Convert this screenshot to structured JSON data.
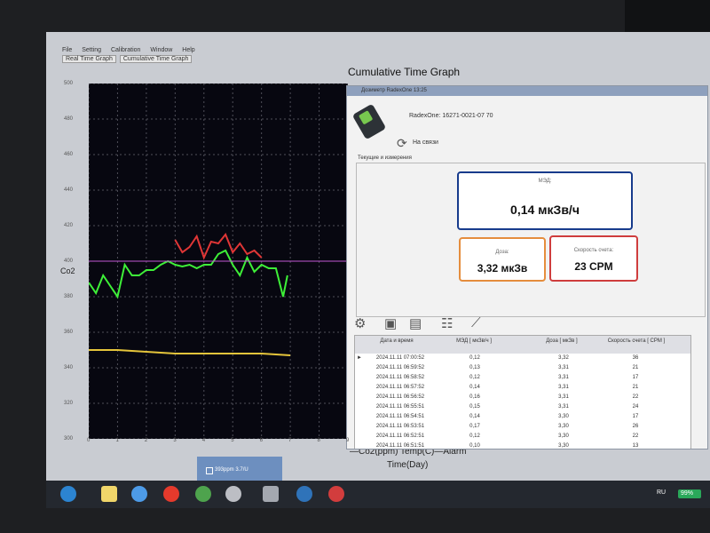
{
  "menu": {
    "items": [
      "File",
      "Setting",
      "Calibration",
      "Window",
      "Help"
    ]
  },
  "tabs": [
    "Real Time Graph",
    "Cumulative Time Graph"
  ],
  "graph": {
    "title": "Cumulative Time Graph",
    "y_axis_label": "Co2",
    "x_axis_label": "Time(Day)",
    "legend": "—Co2(ppm)  Temp(C)—Alarm",
    "status_box": "393ppm 3.7/U"
  },
  "chart_data": {
    "type": "line",
    "xlabel": "Time(Day)",
    "ylabel": "Co2",
    "xlim": [
      0,
      9
    ],
    "ylim": [
      300,
      500
    ],
    "x_ticks": [
      0,
      1,
      2,
      3,
      4,
      5,
      6,
      7,
      8,
      9
    ],
    "y_ticks": [
      300,
      320,
      340,
      360,
      380,
      400,
      420,
      440,
      460,
      480,
      500
    ],
    "grid": true,
    "legend_position": "bottom",
    "series": [
      {
        "name": "Co2(ppm)",
        "color": "#3ef038",
        "x": [
          0,
          0.25,
          0.5,
          0.75,
          1,
          1.25,
          1.5,
          1.75,
          2,
          2.25,
          2.5,
          2.75,
          3,
          3.25,
          3.5,
          3.75,
          4,
          4.25,
          4.5,
          4.75,
          5,
          5.25,
          5.5,
          5.75,
          6,
          6.25,
          6.5,
          6.75,
          6.9
        ],
        "values": [
          388,
          382,
          392,
          386,
          380,
          398,
          392,
          392,
          395,
          395,
          398,
          400,
          398,
          397,
          398,
          396,
          398,
          398,
          404,
          406,
          398,
          392,
          402,
          394,
          398,
          396,
          396,
          380,
          392
        ]
      },
      {
        "name": "Co2 over alarm",
        "color": "#e03636",
        "x": [
          3,
          3.25,
          3.5,
          3.75,
          4,
          4.25,
          4.5,
          4.75,
          5,
          5.25,
          5.5,
          5.75,
          6
        ],
        "values": [
          412,
          405,
          408,
          414,
          402,
          411,
          410,
          415,
          405,
          410,
          404,
          406,
          402
        ]
      },
      {
        "name": "Temp(C)",
        "color": "#e5c53b",
        "x": [
          0,
          1,
          2,
          3,
          4,
          5,
          6,
          7
        ],
        "values": [
          350,
          350,
          349,
          348,
          348,
          348,
          348,
          347
        ]
      },
      {
        "name": "Alarm",
        "color": "#c257d4",
        "x": [
          0,
          9
        ],
        "values": [
          400,
          400
        ]
      }
    ]
  },
  "dialog": {
    "title": "Дозиметр RadexOne 13:25",
    "device_name": "RadexOne: 16271-0021-07 70",
    "connection_status": "На связи",
    "group_label": "Текущие и измерения",
    "mad_label": "МЭД:",
    "mad_value": "0,14 мкЗв/ч",
    "dose_label": "Доза:",
    "dose_value": "3,32 мкЗв",
    "rate_label": "Скорость счета:",
    "rate_value": "23 CPM",
    "table": {
      "headers": [
        "Дата и время",
        "МЭД\n[ мкЗв/ч ]",
        "Доза\n[ мкЗв ]",
        "Скорость счета\n[ CPM ]"
      ],
      "rows": [
        [
          "2024.11.11 07:00:52",
          "0,12",
          "3,32",
          "36"
        ],
        [
          "2024.11.11 06:59:52",
          "0,13",
          "3,31",
          "21"
        ],
        [
          "2024.11.11 06:58:52",
          "0,12",
          "3,31",
          "17"
        ],
        [
          "2024.11.11 06:57:52",
          "0,14",
          "3,31",
          "21"
        ],
        [
          "2024.11.11 06:56:52",
          "0,16",
          "3,31",
          "22"
        ],
        [
          "2024.11.11 06:55:51",
          "0,15",
          "3,31",
          "24"
        ],
        [
          "2024.11.11 06:54:51",
          "0,14",
          "3,30",
          "17"
        ],
        [
          "2024.11.11 06:53:51",
          "0,17",
          "3,30",
          "26"
        ],
        [
          "2024.11.11 06:52:51",
          "0,12",
          "3,30",
          "22"
        ],
        [
          "2024.11.11 06:51:51",
          "0,10",
          "3,30",
          "13"
        ]
      ]
    }
  },
  "taskbar": {
    "tray_language": "RU",
    "battery": "99%"
  },
  "colors": {
    "plot_background": "#070710",
    "mad_border": "#173b8c",
    "dose_border": "#e58d3d",
    "rate_border": "#cf3d3d"
  }
}
